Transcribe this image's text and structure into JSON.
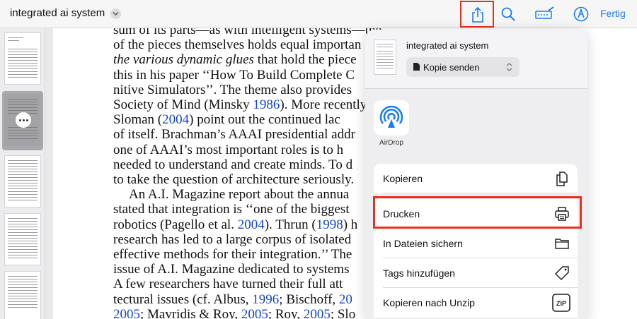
{
  "header": {
    "doc_title": "integrated ai system",
    "done_label": "Fertig",
    "icons": [
      "share-icon",
      "search-icon",
      "markup-icon",
      "pen-icon"
    ]
  },
  "paper": {
    "lines": [
      {
        "t": "sum of its parts—as with intelligent systems—the ",
        "rest": "…"
      },
      {
        "t": "of the pieces themselves holds equal importan"
      },
      {
        "i": "the various dynamic glues",
        "t": " that hold the piece"
      },
      {
        "t": "this in his paper ‘‘How To Build Complete C"
      },
      {
        "t": "nitive Simulators’’. The theme also provides"
      },
      {
        "t": "Society of Mind (Minsky ",
        "l": "1986",
        "t2": "). More recently"
      },
      {
        "t": "Sloman (",
        "l": "2004",
        "t2": ") point out the continued lac"
      },
      {
        "t": "of itself. Brachman’s AAAI presidential addr"
      },
      {
        "t": "one of AAAI’s most important roles is to h"
      },
      {
        "t": "needed to understand and create minds. To d"
      },
      {
        "t": "to take the question of architecture seriously."
      },
      {
        "t": "An A.I. Magazine report about the annua",
        "indent": true
      },
      {
        "t": "stated that integration is ‘‘one of the biggest"
      },
      {
        "t": "robotics (Pagello et al. ",
        "l": "2004",
        "t2": "). Thrun (",
        "l2": "1998",
        "t3": ") h"
      },
      {
        "t": "research has led to a large corpus of isolated"
      },
      {
        "t": "effective methods for their integration.’’ The"
      },
      {
        "t": "issue of A.I. Magazine dedicated to systems"
      },
      {
        "t": "A few researchers have turned their full att"
      },
      {
        "t": "tectural issues (cf. Albus, ",
        "l": "1996",
        "t2": "; Bischoff, ",
        "l2": "20"
      },
      {
        "l": "2005",
        "t2": "; Mavridis & Roy, ",
        "l2": "2005",
        "t3": "; Roy, ",
        "l3": "2005",
        "t4": "; Slo"
      }
    ]
  },
  "share_sheet": {
    "doc_name": "integrated ai system",
    "send_option": "Kopie senden",
    "airdrop_label": "AirDrop",
    "actions": [
      {
        "label": "Kopieren",
        "icon": "copy-icon"
      },
      {
        "label": "Drucken",
        "icon": "printer-icon"
      },
      {
        "label": "In Dateien sichern",
        "icon": "folder-icon"
      },
      {
        "label": "Tags hinzufügen",
        "icon": "tag-icon"
      },
      {
        "label": "Kopieren nach Unzip",
        "icon": "zip-icon"
      }
    ],
    "zip_text": "ZIP"
  },
  "colors": {
    "accent": "#1a7bf5",
    "highlight": "#e8311d",
    "link": "#1545c8"
  }
}
